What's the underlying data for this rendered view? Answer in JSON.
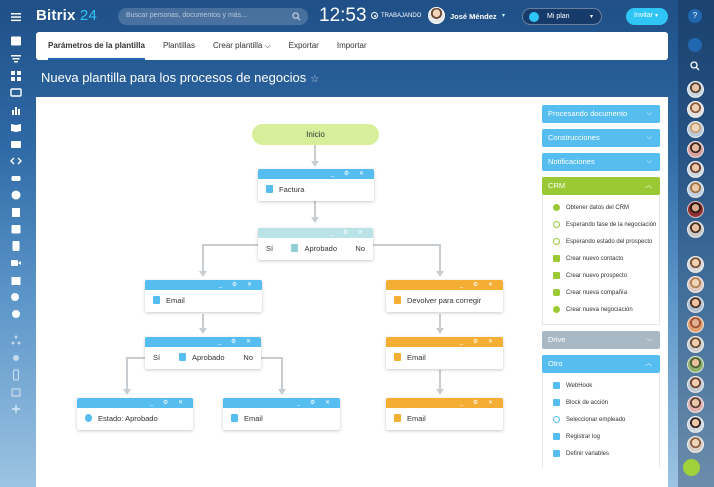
{
  "header": {
    "logo_main": "Bitrix",
    "logo_num": "24",
    "search_placeholder": "Buscar personas, documentos y más...",
    "clock": "12:53",
    "work_status": "TRABAJANDO",
    "user_name": "José Méndez",
    "plan_label": "Mi plan",
    "invite_label": "Invitar"
  },
  "tabs": [
    {
      "label": "Parámetros de la plantilla",
      "active": true
    },
    {
      "label": "Plantillas"
    },
    {
      "label": "Crear plantilla ⌵"
    },
    {
      "label": "Exportar"
    },
    {
      "label": "Importar"
    }
  ],
  "page_title": "Nueva plantilla para los procesos de negocios",
  "flow": {
    "start": "Inicio",
    "factura": "Factura",
    "cond1": {
      "yes": "Sí",
      "label": "Aprobado",
      "no": "No"
    },
    "email1": "Email",
    "devolver": "Devolver para corregir",
    "cond2": {
      "yes": "Sí",
      "label": "Aprobado",
      "no": "No"
    },
    "email_right": "Email",
    "estado": "Estado: Aprobado",
    "email_mid": "Email",
    "email_bottom": "Email"
  },
  "sidebar": {
    "sections": {
      "procesando": "Procesando documento",
      "construcciones": "Construcciones",
      "notificaciones": "Notificaciones",
      "crm": "CRM",
      "drive": "Drive",
      "otro": "Otro"
    },
    "crm_items": [
      "Obtener datos del CRM",
      "Esperando fase de la negociación",
      "Esperando estado del prospecto",
      "Crear nuevo contacto",
      "Crear nuevo prospecto",
      "Crear nueva compañía",
      "Crear nueva negociación"
    ],
    "otro_items": [
      "WebHook",
      "Block de acción",
      "Seleccionar empleado",
      "Registrar log",
      "Definir variables"
    ]
  },
  "colors": {
    "blue_header": "#55bdf0",
    "teal_header": "#b9e3e6",
    "orange_header": "#f4ae34",
    "section_blue": "#55bdf0",
    "section_green": "#9ac935",
    "section_gray": "#a9b8c5",
    "accent": "#2fc6f6"
  }
}
